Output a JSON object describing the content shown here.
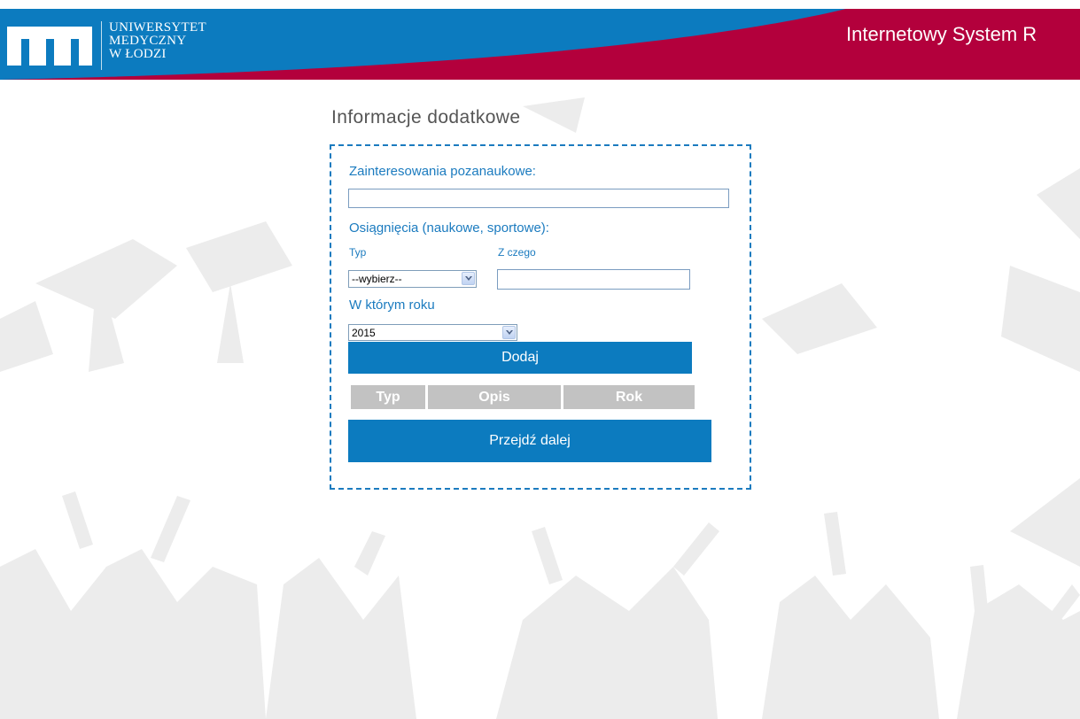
{
  "header": {
    "logo_lines": [
      "UNIWERSYTET",
      "MEDYCZNY",
      "W ŁODZI"
    ],
    "system_title": "Internetowy System R"
  },
  "page_title": "Informacje dodatkowe",
  "form": {
    "hobbies_label": "Zainteresowania pozanaukowe:",
    "hobbies_value": "",
    "achievements_label": "Osiągnięcia (naukowe, sportowe):",
    "type_label": "Typ",
    "from_what_label": "Z czego",
    "type_select_value": "--wybierz--",
    "from_what_value": "",
    "year_label": "W którym roku",
    "year_select_value": "2015",
    "add_button": "Dodaj",
    "table_headers": [
      "Typ",
      "Opis",
      "Rok"
    ],
    "next_button": "Przejdź dalej"
  },
  "colors": {
    "header_blue": "#0c7bbf",
    "header_red": "#b3003c",
    "accent": "#1b7bbf",
    "table_header_bg": "#c2c2c2"
  }
}
